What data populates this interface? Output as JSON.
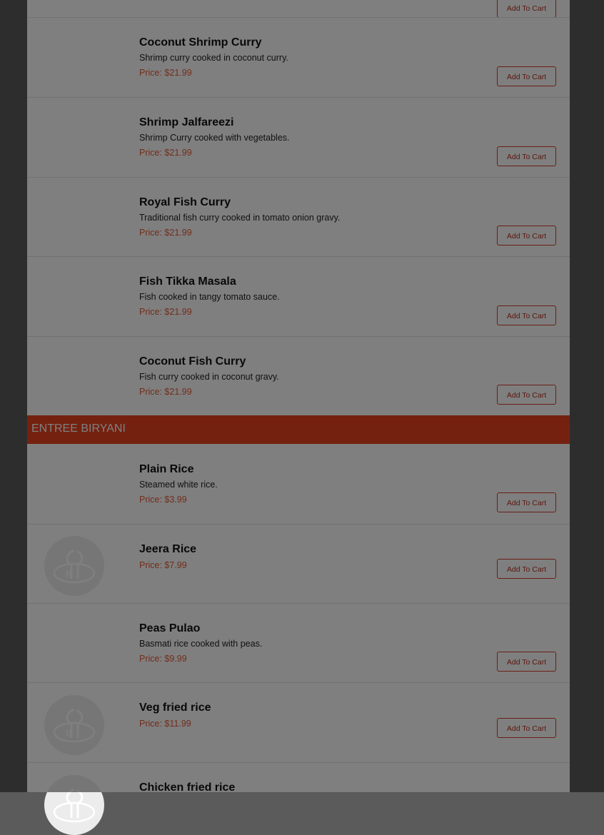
{
  "colors": {
    "price": "#e65a35",
    "section_bar": "#e8431e",
    "button_border": "#d43d2a",
    "overlay": "rgba(0,0,0,0.5)"
  },
  "add_to_cart_label": "Add To Cart",
  "section": {
    "title": "ENTREE BIRYANI"
  },
  "items": [
    {
      "name": "Coconut Shrimp Curry",
      "description": "Shrimp curry cooked in coconut curry.",
      "price": "Price: $21.99"
    },
    {
      "name": "Shrimp Jalfareezi",
      "description": "Shrimp Curry cooked with vegetables.",
      "price": "Price: $21.99"
    },
    {
      "name": "Royal Fish Curry",
      "description": "Traditional fish curry cooked in tomato onion gravy.",
      "price": "Price: $21.99"
    },
    {
      "name": "Fish Tikka Masala",
      "description": "Fish cooked in tangy tomato sauce.",
      "price": "Price: $21.99"
    },
    {
      "name": "Coconut Fish Curry",
      "description": "Fish curry cooked in coconut gravy.",
      "price": "Price: $21.99"
    },
    {
      "name": "Plain Rice",
      "description": "Steamed white rice.",
      "price": "Price: $3.99"
    },
    {
      "name": "Jeera Rice",
      "price": "Price: $7.99",
      "icon": "restaurant-logo-icon"
    },
    {
      "name": "Peas Pulao",
      "description": "Basmati rice cooked with peas.",
      "price": "Price: $9.99"
    },
    {
      "name": "Veg fried rice",
      "price": "Price: $11.99",
      "icon": "restaurant-logo-icon"
    },
    {
      "name": "Chicken fried rice",
      "icon": "restaurant-logo-icon"
    }
  ]
}
